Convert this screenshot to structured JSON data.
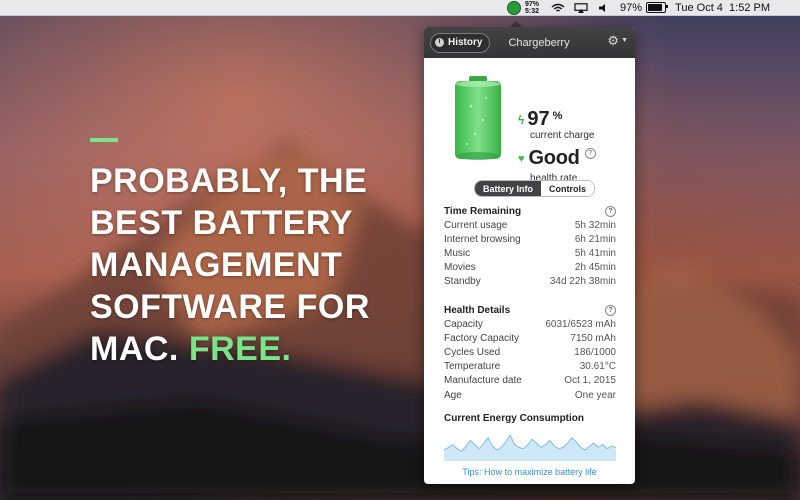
{
  "menubar": {
    "app_percent": "97%",
    "app_time": "5:32",
    "battery_percent": "97%",
    "datetime": "Tue Oct 4  1:52 PM"
  },
  "marketing": {
    "line1": "PROBABLY, THE",
    "line2": "BEST BATTERY",
    "line3": "MANAGEMENT",
    "line4": "SOFTWARE FOR",
    "line5a": "MAC. ",
    "line5b": "FREE.",
    "accent_color": "#7be38a"
  },
  "popover": {
    "history_label": "History",
    "title": "Chargeberry",
    "charge_value": "97",
    "charge_unit": "%",
    "charge_label": "current charge",
    "health_value": "Good",
    "health_label": "health rate",
    "help_glyph": "?",
    "tabs": [
      {
        "label": "Battery Info",
        "active": true
      },
      {
        "label": "Controls",
        "active": false
      }
    ],
    "time_remaining": {
      "title": "Time Remaining",
      "rows": [
        {
          "label": "Current usage",
          "value": "5h 32min"
        },
        {
          "label": "Internet browsing",
          "value": "6h 21min"
        },
        {
          "label": "Music",
          "value": "5h 41min"
        },
        {
          "label": "Movies",
          "value": "2h 45min"
        },
        {
          "label": "Standby",
          "value": "34d 22h 38min"
        }
      ]
    },
    "health_details": {
      "title": "Health Details",
      "rows": [
        {
          "label": "Capacity",
          "value": "6031/6523 mAh"
        },
        {
          "label": "Factory Capacity",
          "value": "7150 mAh"
        },
        {
          "label": "Cycles Used",
          "value": "186/1000"
        },
        {
          "label": "Temperature",
          "value": "30.61°C"
        },
        {
          "label": "Manufacture date",
          "value": "Oct 1, 2015"
        },
        {
          "label": "Age",
          "value": "One year"
        }
      ]
    },
    "energy_title": "Current Energy Consumption",
    "tip_link": "Tips: How to maximize battery life",
    "green_color": "#3dbb4a",
    "link_color": "#3b8fd6"
  },
  "chart_data": {
    "type": "area",
    "title": "Current Energy Consumption",
    "xlabel": "",
    "ylabel": "",
    "values": [
      8,
      10,
      12,
      9,
      7,
      11,
      15,
      12,
      9,
      13,
      17,
      11,
      8,
      10,
      14,
      19,
      12,
      10,
      9,
      12,
      16,
      13,
      10,
      12,
      15,
      11,
      9,
      10,
      13,
      17,
      14,
      10,
      8,
      11,
      13,
      10,
      12,
      9,
      11,
      10
    ],
    "ylim": [
      0,
      22
    ],
    "grid": false
  }
}
